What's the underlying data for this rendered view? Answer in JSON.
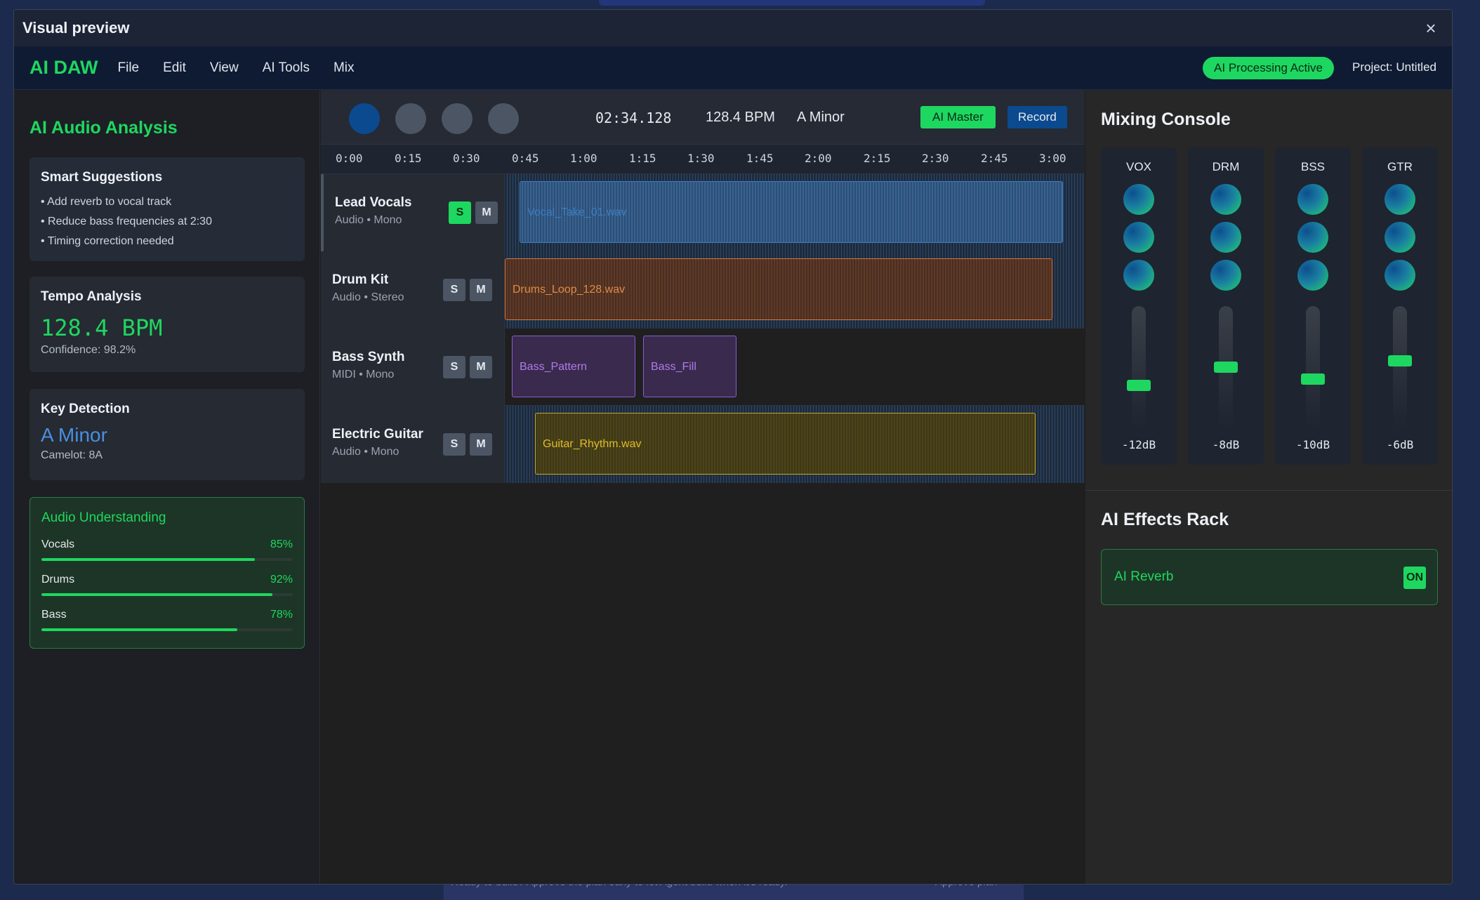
{
  "background": {
    "bottom_text_left": "Ready to build? Approve the plan early to let Agent build when it's ready.",
    "bottom_text_right": "Approve plan"
  },
  "window": {
    "title": "Visual preview",
    "close_glyph": "×"
  },
  "menubar": {
    "brand": "AI DAW",
    "items": [
      "File",
      "Edit",
      "View",
      "AI Tools",
      "Mix"
    ],
    "status_badge": "AI Processing Active",
    "project": "Project: Untitled",
    "brand_color": "#1ed760"
  },
  "analysis": {
    "title": "AI Audio Analysis",
    "suggestions": {
      "title": "Smart Suggestions",
      "items": [
        "• Add reverb to vocal track",
        "• Reduce bass frequencies at 2:30",
        "• Timing correction needed"
      ]
    },
    "tempo": {
      "title": "Tempo Analysis",
      "value": "128.4 BPM",
      "confidence": "Confidence: 98.2%"
    },
    "key": {
      "title": "Key Detection",
      "value": "A Minor",
      "camelot": "Camelot: 8A"
    },
    "understanding": {
      "title": "Audio Understanding",
      "items": [
        {
          "label": "Vocals",
          "percent": "85%",
          "level": 0.85
        },
        {
          "label": "Drums",
          "percent": "92%",
          "level": 0.92
        },
        {
          "label": "Bass",
          "percent": "78%",
          "level": 0.78
        }
      ]
    }
  },
  "transport": {
    "buttons": [
      "play-icon",
      "stop-icon",
      "rewind-icon",
      "forward-icon"
    ],
    "time": "02:34.128",
    "bpm": "128.4 BPM",
    "key": "A Minor",
    "ai_master": "AI Master",
    "record": "Record"
  },
  "timeline": {
    "ticks": [
      "0:00",
      "0:15",
      "0:30",
      "0:45",
      "1:00",
      "1:15",
      "1:30",
      "1:45",
      "2:00",
      "2:15",
      "2:30",
      "2:45",
      "3:00"
    ]
  },
  "tracks": [
    {
      "name": "Lead Vocals",
      "sub": "Audio • Mono",
      "solo": "S",
      "mute": "M",
      "solo_on": true,
      "clips": [
        {
          "label": "Vocal_Take_01.wav",
          "color": "blue"
        }
      ]
    },
    {
      "name": "Drum Kit",
      "sub": "Audio • Stereo",
      "solo": "S",
      "mute": "M",
      "solo_on": false,
      "clips": [
        {
          "label": "Drums_Loop_128.wav",
          "color": "orange"
        }
      ]
    },
    {
      "name": "Bass Synth",
      "sub": "MIDI • Mono",
      "solo": "S",
      "mute": "M",
      "solo_on": false,
      "clips": [
        {
          "label": "Bass_Pattern",
          "color": "purple"
        },
        {
          "label": "Bass_Fill",
          "color": "purple"
        }
      ]
    },
    {
      "name": "Electric Guitar",
      "sub": "Audio • Mono",
      "solo": "S",
      "mute": "M",
      "solo_on": false,
      "clips": [
        {
          "label": "Guitar_Rhythm.wav",
          "color": "yellow"
        }
      ]
    }
  ],
  "mixer": {
    "title": "Mixing Console",
    "channels": [
      {
        "label": "VOX",
        "db": "-12dB"
      },
      {
        "label": "DRM",
        "db": "-8dB"
      },
      {
        "label": "BSS",
        "db": "-10dB"
      },
      {
        "label": "GTR",
        "db": "-6dB"
      }
    ]
  },
  "effects": {
    "title": "AI Effects Rack",
    "items": [
      {
        "name": "AI Reverb",
        "state": "ON"
      }
    ]
  }
}
